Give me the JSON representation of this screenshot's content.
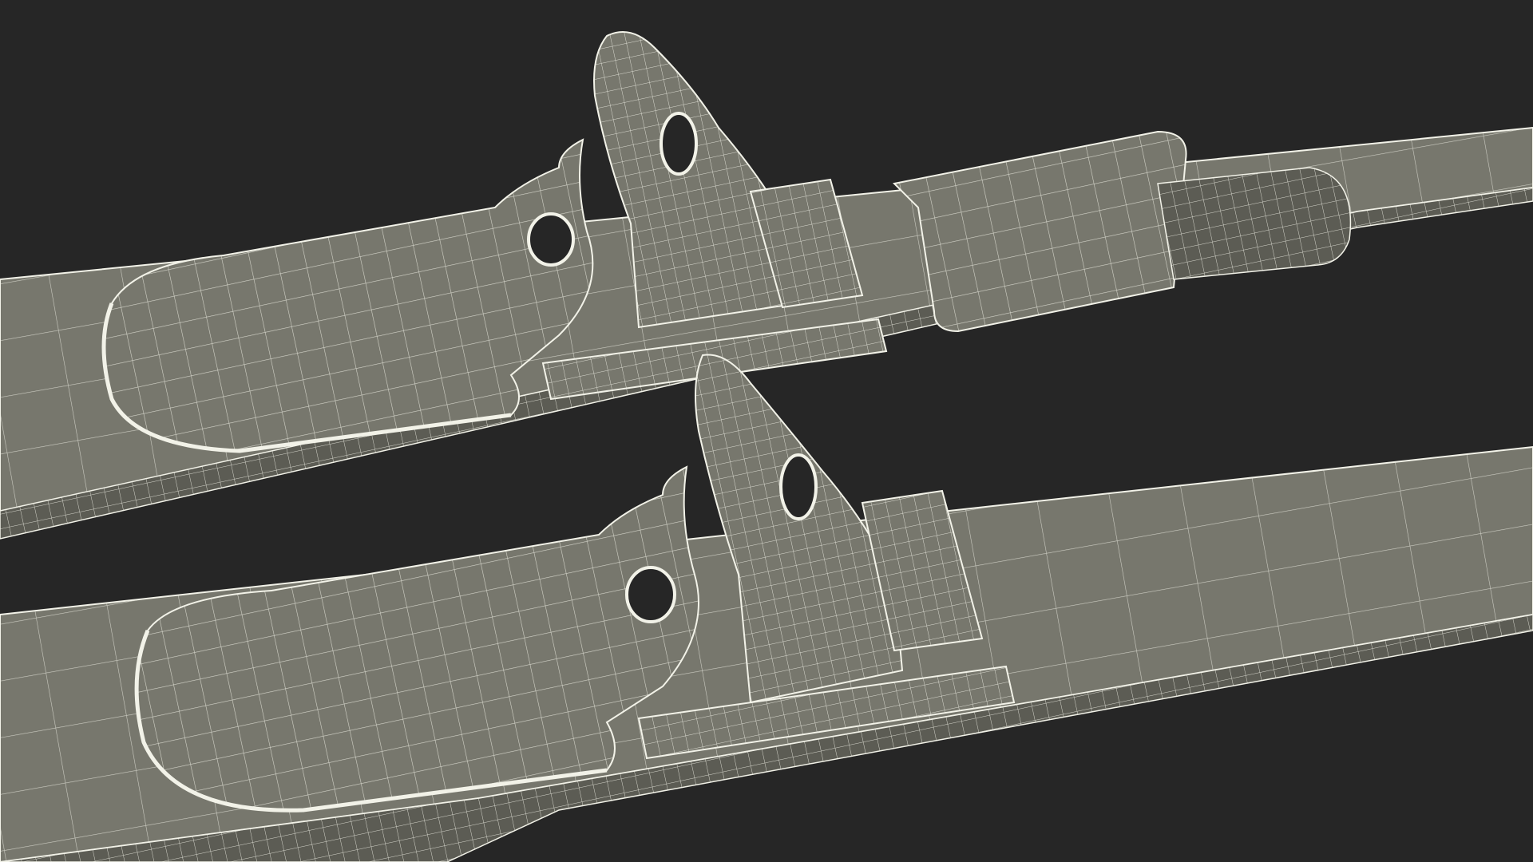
{
  "scene": {
    "background_color": "#262626",
    "surface_color": "#77776d",
    "surface_shadow_color": "#5c5c54",
    "highlight_color": "#8a8a80",
    "wire_color": "#f2f2e8",
    "objects": [
      {
        "name": "upper-ski",
        "parts": [
          "ski-plate",
          "toe-cup",
          "heel-fin",
          "heel-bar",
          "rear-strap"
        ]
      },
      {
        "name": "lower-ski",
        "parts": [
          "ski-plate",
          "toe-cup",
          "heel-fin",
          "heel-bar"
        ]
      }
    ]
  }
}
